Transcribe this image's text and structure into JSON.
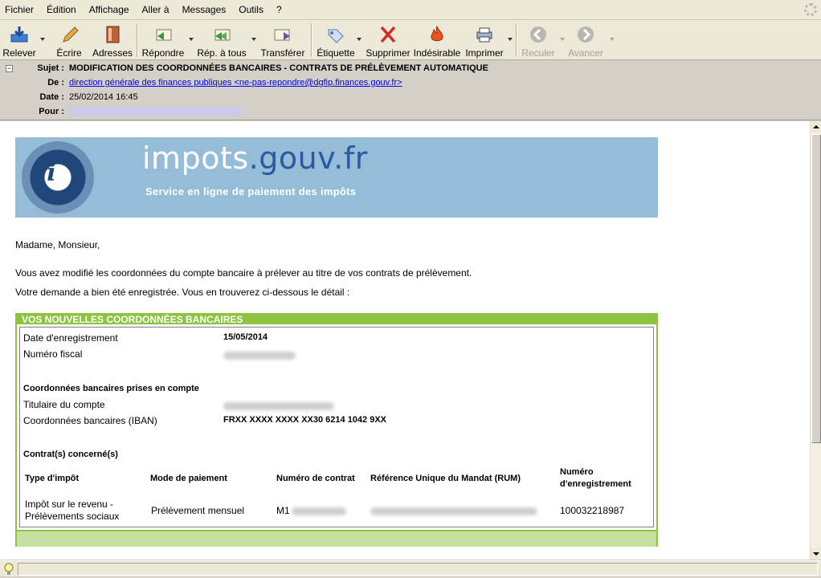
{
  "menu": [
    "Fichier",
    "Édition",
    "Affichage",
    "Aller à",
    "Messages",
    "Outils",
    "?"
  ],
  "toolbar": {
    "releve": "Relever",
    "ecrire": "Écrire",
    "adresses": "Adresses",
    "repondre": "Répondre",
    "rep_tous": "Rép. à tous",
    "transferer": "Transférer",
    "etiquette": "Étiquette",
    "supprimer": "Supprimer",
    "indesirable": "Indésirable",
    "imprimer": "Imprimer",
    "reculer": "Reculer",
    "avancer": "Avancer"
  },
  "headers": {
    "subject_label": "Sujet :",
    "subject": "MODIFICATION DES COORDONNÉES BANCAIRES - CONTRATS DE PRÉLÈVEMENT AUTOMATIQUE",
    "from_label": "De :",
    "from": "direction générale des finances publiques <ne-pas-repondre@dgfip.finances.gouv.fr>",
    "date_label": "Date :",
    "date": "25/02/2014 16:45",
    "to_label": "Pour :"
  },
  "banner": {
    "brand_a": "impots",
    "brand_dot": ".",
    "brand_b": "gouv.fr",
    "tagline": "Service en ligne de paiement des impôts"
  },
  "body": {
    "greeting": "Madame, Monsieur,",
    "line1": "Vous avez modifié les coordonnées du compte bancaire à prélever au titre de vos contrats de prélèvement.",
    "line2": "Votre demande a bien été enregistrée. Vous en trouverez ci-dessous le détail :"
  },
  "details": {
    "title": "VOS NOUVELLES COORDONNÉES BANCAIRES",
    "date_label": "Date d'enregistrement",
    "date_value": "15/05/2014",
    "fiscal_label": "Numéro fiscal",
    "bank_section": "Coordonnées bancaires prises en compte",
    "holder_label": "Titulaire du compte",
    "iban_label": "Coordonnées bancaires (IBAN)",
    "iban_value": "FRXX XXXX XXXX XX30 6214 1042 9XX",
    "contracts_section": "Contrat(s) concerné(s)",
    "col_type": "Type d'impôt",
    "col_mode": "Mode de paiement",
    "col_contract": "Numéro de contrat",
    "col_rum": "Référence Unique du Mandat (RUM)",
    "col_reg_1": "Numéro",
    "col_reg_2": "d'enregistrement",
    "row_type_1": "Impôt sur le revenu -",
    "row_type_2": "Prélèvements sociaux",
    "row_mode": "Prélèvement mensuel",
    "row_contract_prefix": "M1",
    "row_reg": "100032218987"
  }
}
